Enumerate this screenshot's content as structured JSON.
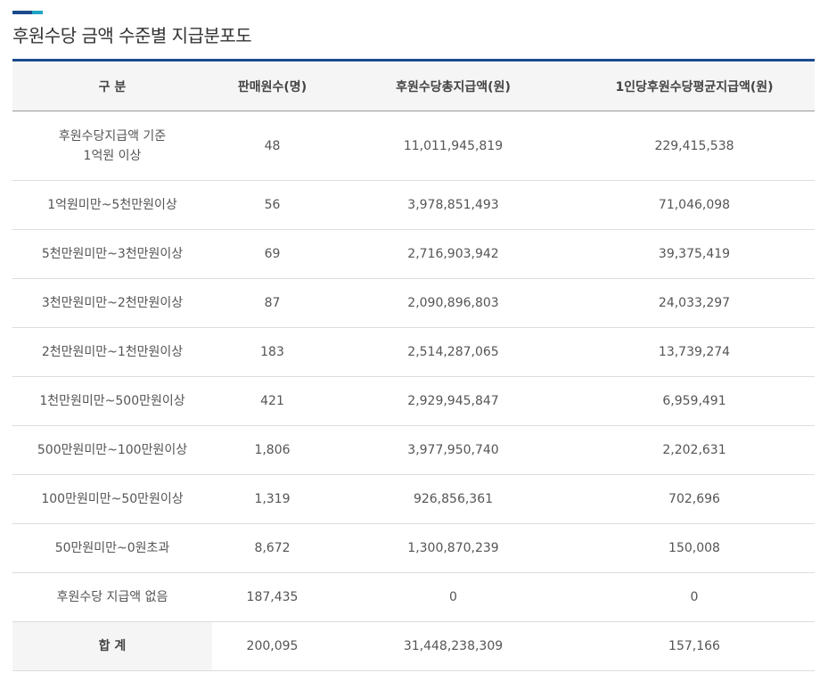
{
  "title": "후원수당 금액 수준별 지급분포도",
  "colors": {
    "accent_dark": "#1a4a8c",
    "accent_light": "#1ea5c4",
    "header_bg": "#f5f5f5"
  },
  "headers": [
    "구 분",
    "판매원수(명)",
    "후원수당총지급액(원)",
    "1인당후원수당평균지급액(원)"
  ],
  "rows": [
    {
      "category": "후원수당지급액 기준\n1억원 이상",
      "count": "48",
      "total": "11,011,945,819",
      "avg": "229,415,538"
    },
    {
      "category": "1억원미만~5천만원이상",
      "count": "56",
      "total": "3,978,851,493",
      "avg": "71,046,098"
    },
    {
      "category": "5천만원미만~3천만원이상",
      "count": "69",
      "total": "2,716,903,942",
      "avg": "39,375,419"
    },
    {
      "category": "3천만원미만~2천만원이상",
      "count": "87",
      "total": "2,090,896,803",
      "avg": "24,033,297"
    },
    {
      "category": "2천만원미만~1천만원이상",
      "count": "183",
      "total": "2,514,287,065",
      "avg": "13,739,274"
    },
    {
      "category": "1천만원미만~500만원이상",
      "count": "421",
      "total": "2,929,945,847",
      "avg": "6,959,491"
    },
    {
      "category": "500만원미만~100만원이상",
      "count": "1,806",
      "total": "3,977,950,740",
      "avg": "2,202,631"
    },
    {
      "category": "100만원미만~50만원이상",
      "count": "1,319",
      "total": "926,856,361",
      "avg": "702,696"
    },
    {
      "category": "50만원미만~0원초과",
      "count": "8,672",
      "total": "1,300,870,239",
      "avg": "150,008"
    },
    {
      "category": "후원수당 지급액 없음",
      "count": "187,435",
      "total": "0",
      "avg": "0"
    }
  ],
  "total_row": {
    "category": "합 계",
    "count": "200,095",
    "total": "31,448,238,309",
    "avg": "157,166"
  }
}
